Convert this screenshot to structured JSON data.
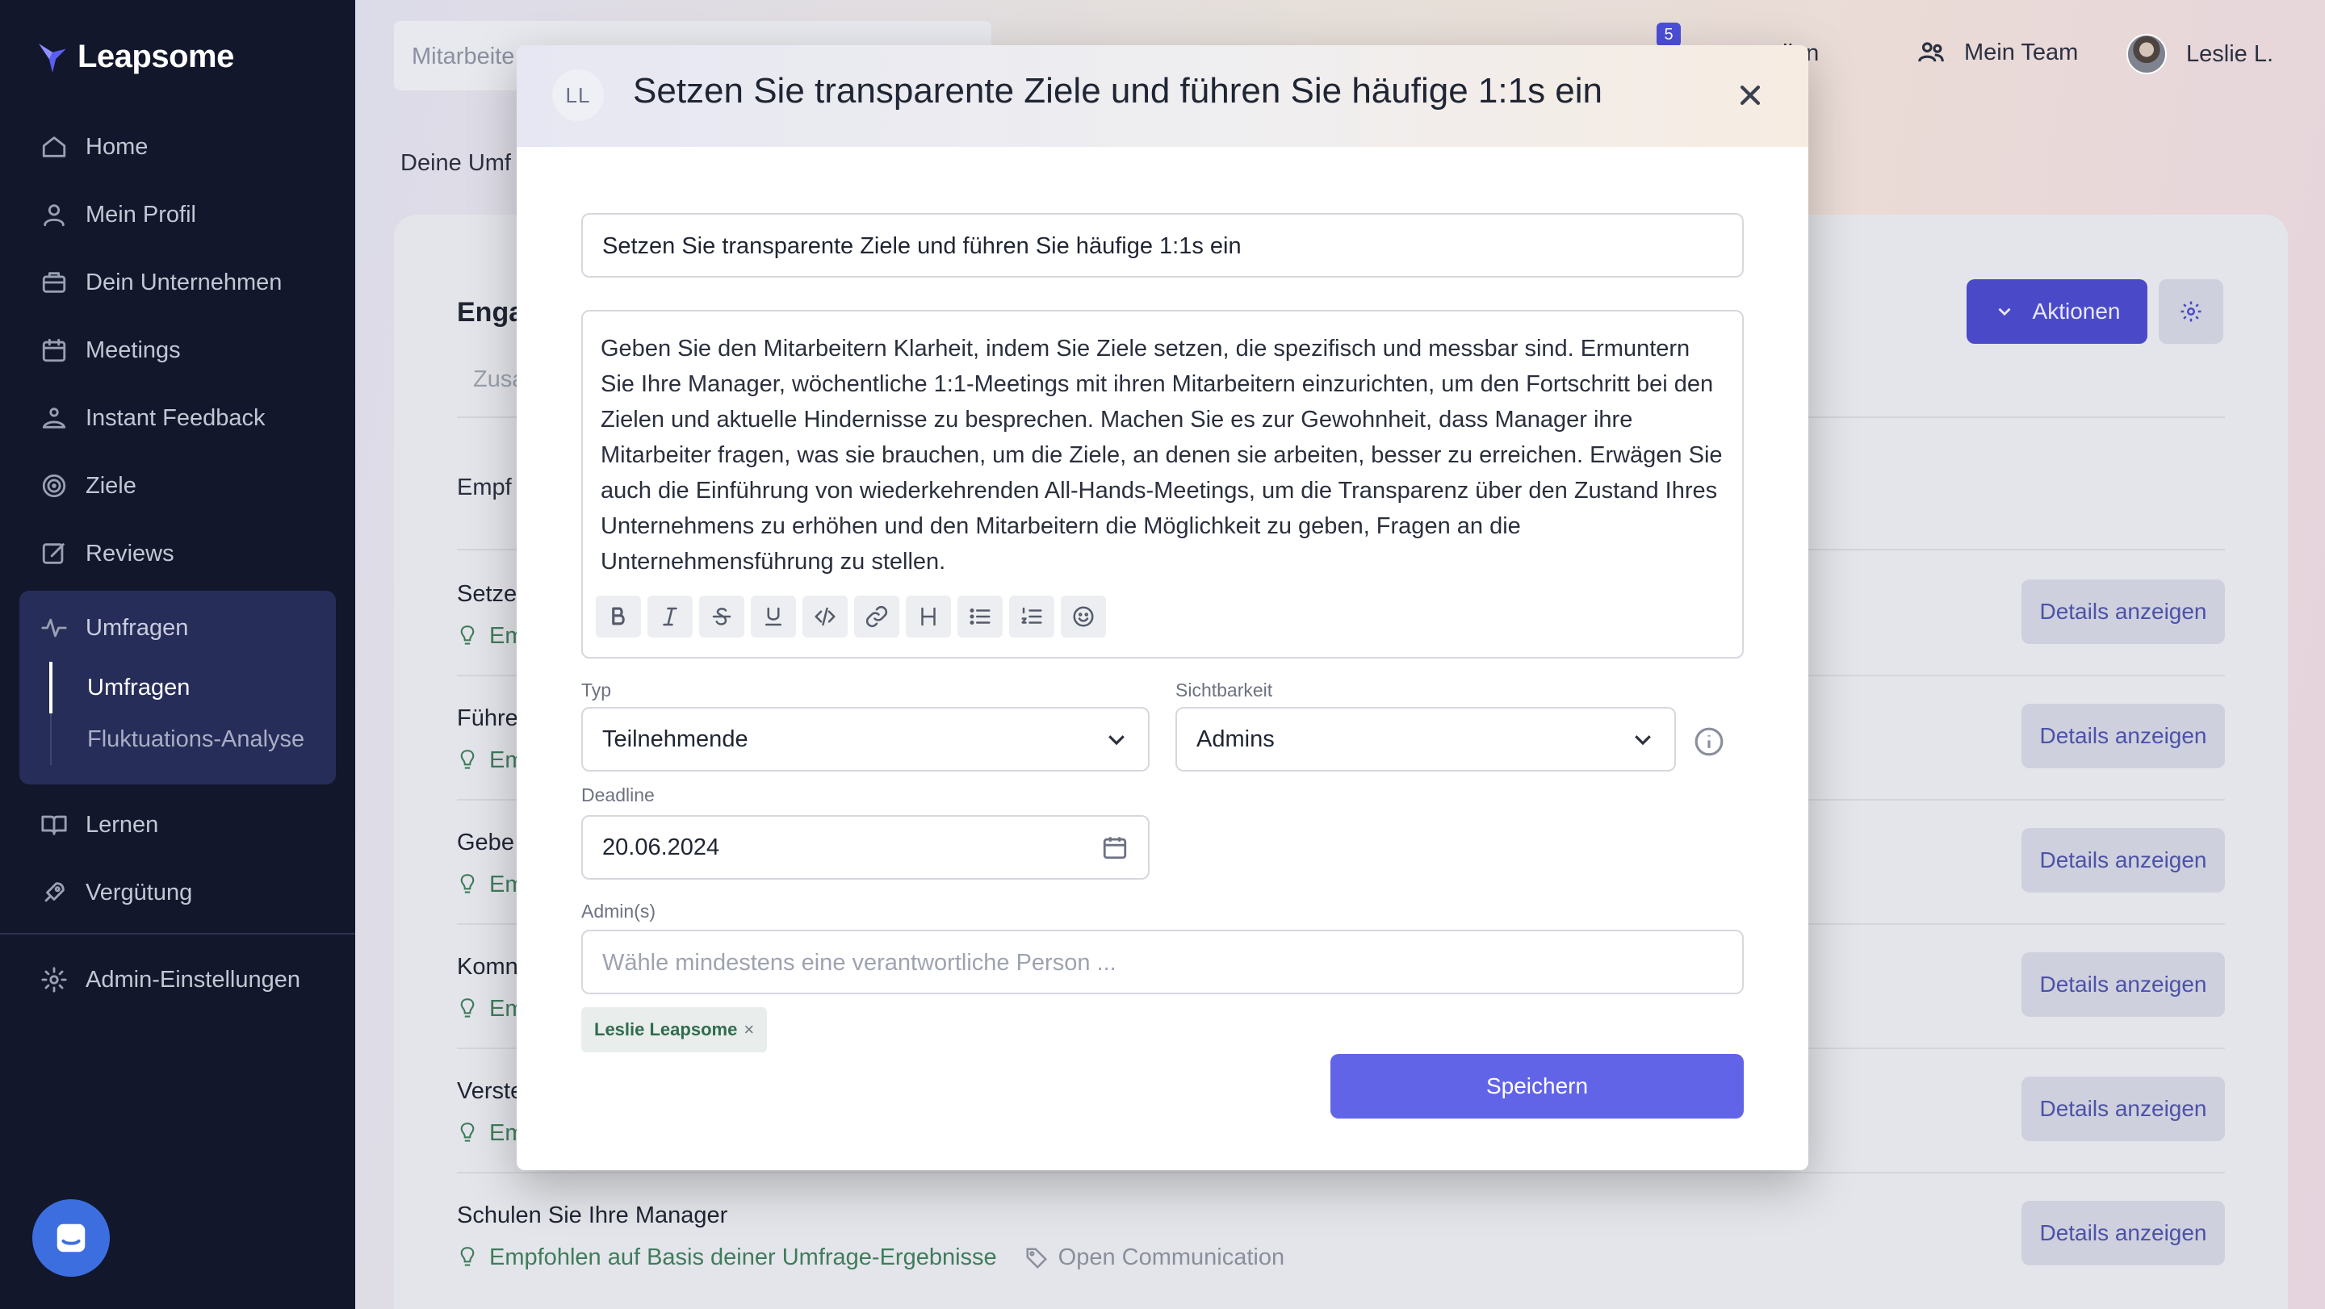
{
  "app": {
    "name": "Leapsome"
  },
  "sidebar": {
    "items": [
      {
        "label": "Home",
        "icon": "home-icon"
      },
      {
        "label": "Mein Profil",
        "icon": "user-icon"
      },
      {
        "label": "Dein Unternehmen",
        "icon": "building-icon"
      },
      {
        "label": "Meetings",
        "icon": "calendar-icon"
      },
      {
        "label": "Instant Feedback",
        "icon": "feedback-icon"
      },
      {
        "label": "Ziele",
        "icon": "target-icon"
      },
      {
        "label": "Reviews",
        "icon": "edit-icon"
      }
    ],
    "active_group": {
      "label": "Umfragen",
      "icon": "pulse-icon",
      "children": [
        "Umfragen",
        "Fluktuations-Analyse"
      ]
    },
    "bottom_items": [
      {
        "label": "Lernen",
        "icon": "book-icon"
      },
      {
        "label": "Vergütung",
        "icon": "rocket-icon"
      }
    ],
    "admin": {
      "label": "Admin-Einstellungen",
      "icon": "gear-icon"
    }
  },
  "topbar": {
    "search_placeholder": "Mitarbeite",
    "notification_count": "5",
    "link_partial": "ellen",
    "team_label": "Mein Team",
    "user_name": "Leslie L."
  },
  "breadcrumb": "Deine Umf",
  "card": {
    "title": "Enga",
    "tab": "Zusa",
    "subheading": "Empf",
    "aktionen_label": "Aktionen",
    "rows": [
      {
        "title": "Setze",
        "meta": "Em"
      },
      {
        "title": "Führe",
        "meta": "Em"
      },
      {
        "title": "Gebe",
        "meta": "Em"
      },
      {
        "title": "Komn",
        "meta": "Em"
      },
      {
        "title": "Verste",
        "meta": "Em"
      },
      {
        "title": "Schulen Sie Ihre Manager",
        "meta": "Empfohlen auf Basis deiner Umfrage-Ergebnisse",
        "tag": "Open Communication"
      }
    ],
    "details_label": "Details anzeigen"
  },
  "modal": {
    "avatar_initials": "LL",
    "title": "Setzen Sie transparente Ziele und führen Sie häufige 1:1s ein",
    "title_input_value": "Setzen Sie transparente Ziele und führen Sie häufige 1:1s ein",
    "description": "Geben Sie den Mitarbeitern Klarheit, indem Sie Ziele setzen, die spezifisch und messbar sind. Ermuntern Sie Ihre Manager, wöchentliche 1:1-Meetings mit ihren Mitarbeitern einzurichten, um den Fortschritt bei den Zielen und aktuelle Hindernisse zu besprechen. Machen Sie es zur Gewohnheit, dass Manager ihre Mitarbeiter fragen, was sie brauchen, um die Ziele, an denen sie arbeiten, besser zu erreichen. Erwägen Sie auch die Einführung von wiederkehrenden All-Hands-Meetings, um die Transparenz über den Zustand Ihres Unternehmens zu erhöhen und den Mitarbeitern die Möglichkeit zu geben, Fragen an die Unternehmensführung zu stellen.",
    "toolbar": [
      "bold-icon",
      "italic-icon",
      "strikethrough-icon",
      "underline-icon",
      "code-icon",
      "link-icon",
      "heading-icon",
      "bullet-list-icon",
      "numbered-list-icon",
      "emoji-icon"
    ],
    "typ_label": "Typ",
    "typ_value": "Teilnehmende",
    "sichtbarkeit_label": "Sichtbarkeit",
    "sichtbarkeit_value": "Admins",
    "deadline_label": "Deadline",
    "deadline_value": "20.06.2024",
    "admins_label": "Admin(s)",
    "admins_placeholder": "Wähle mindestens eine verantwortliche Person ...",
    "chip_label": "Leslie Leapsome",
    "chip_remove": "×",
    "save_label": "Speichern"
  },
  "colors": {
    "sidebar_bg": "#12172b",
    "accent": "#6264e8",
    "primary_dark": "#4a4ac8",
    "success_text": "#3f7c5c"
  }
}
